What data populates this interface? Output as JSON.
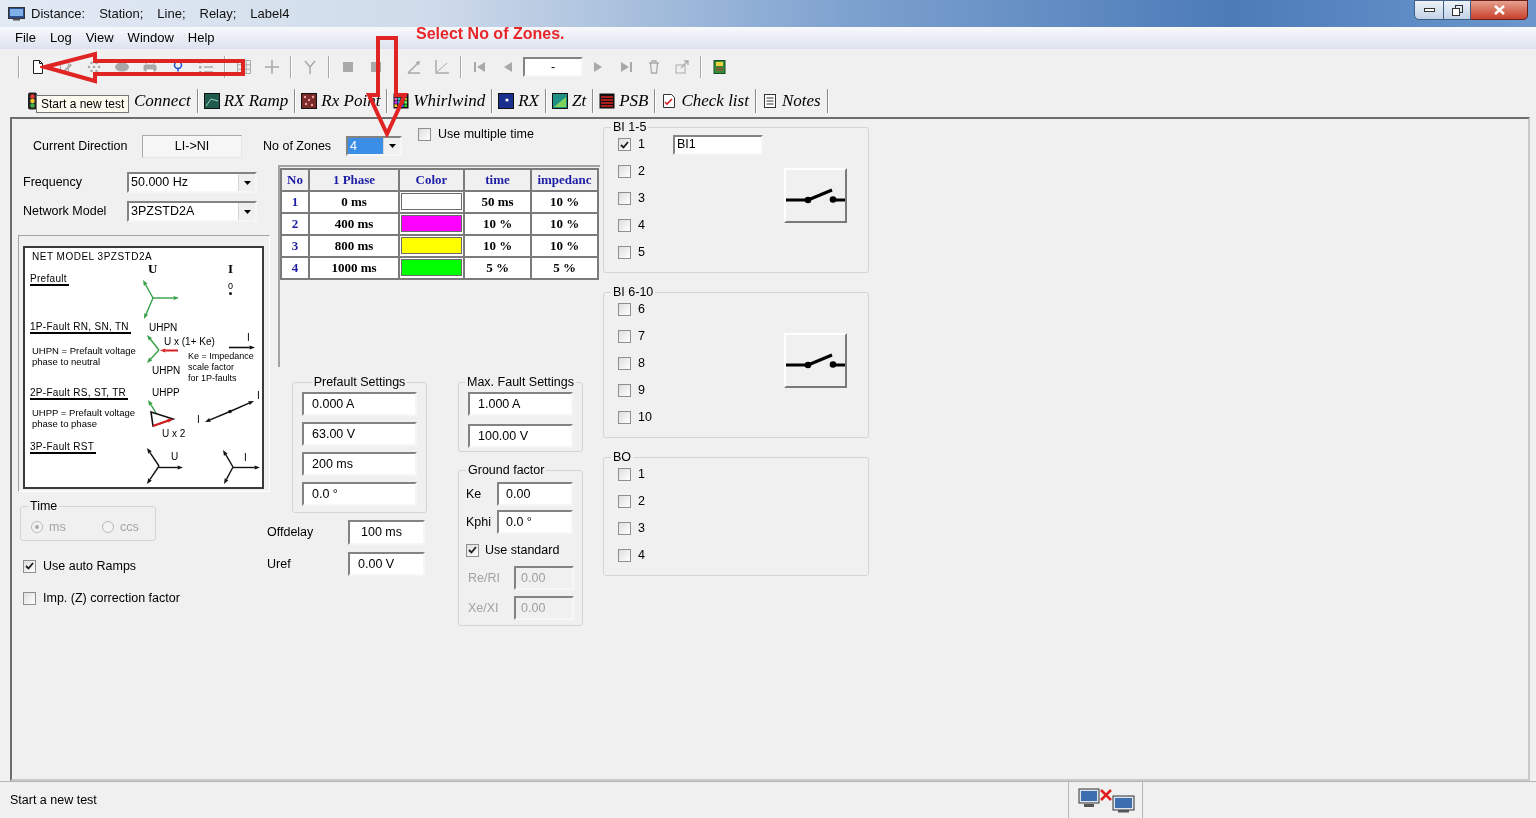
{
  "window": {
    "title": [
      "Distance:",
      "Station;",
      "Line;",
      "Relay;",
      "Label4"
    ]
  },
  "menu": [
    "File",
    "Log",
    "View",
    "Window",
    "Help"
  ],
  "annotation": "Select No of Zones.",
  "toolbar": {
    "groups": [
      [
        {
          "kind": "new",
          "disabled": false
        },
        {
          "kind": "edit",
          "disabled": true
        },
        {
          "kind": "dots",
          "disabled": true
        },
        {
          "kind": "ellipse",
          "disabled": true
        },
        {
          "kind": "printer",
          "disabled": true
        },
        {
          "kind": "marker",
          "disabled": false
        },
        {
          "kind": "list",
          "disabled": true
        }
      ],
      [
        {
          "kind": "grid",
          "disabled": true
        },
        {
          "kind": "plus",
          "disabled": true
        }
      ],
      [
        {
          "kind": "fork",
          "disabled": true
        }
      ],
      [
        {
          "kind": "square",
          "disabled": true
        },
        {
          "kind": "square",
          "disabled": true
        }
      ],
      [
        {
          "kind": "angle",
          "disabled": true
        },
        {
          "kind": "axes",
          "disabled": true
        }
      ],
      [
        {
          "kind": "first",
          "disabled": true
        },
        {
          "kind": "previous",
          "disabled": true
        },
        {
          "kind": "field",
          "value": "-"
        },
        {
          "kind": "next",
          "disabled": true
        },
        {
          "kind": "last",
          "disabled": true
        },
        {
          "kind": "bin",
          "disabled": true
        },
        {
          "kind": "export",
          "disabled": true
        }
      ],
      [
        {
          "kind": "book",
          "disabled": false
        }
      ]
    ]
  },
  "tooltip": "Start a new test",
  "tabs": [
    {
      "label": "Connect"
    },
    {
      "label": "RX Ramp"
    },
    {
      "label": "Rx Point"
    },
    {
      "label": "Whirlwind"
    },
    {
      "label": "RX"
    },
    {
      "label": "Zt"
    },
    {
      "label": "PSB"
    },
    {
      "label": "Check list"
    },
    {
      "label": "Notes"
    }
  ],
  "connection": {
    "current_direction": {
      "label": "Current Direction",
      "value": "LI->NI"
    },
    "zones": {
      "label": "No of Zones",
      "value": "4"
    },
    "multiple_time": {
      "label": "Use multiple time",
      "checked": false
    },
    "frequency": {
      "label": "Frequency",
      "value": "50.000 Hz"
    },
    "network_model": {
      "label": "Network Model",
      "value": "3PZSTD2A"
    }
  },
  "network_diagram": {
    "title": "NET MODEL 3PZSTD2A",
    "sections": [
      {
        "heading": "Prefault"
      },
      {
        "heading": "1P-Fault RN, SN, TN",
        "note": [
          "UHPN = Prefault voltage",
          "phase to neutral"
        ]
      },
      {
        "heading": "2P-Fault RS, ST, TR",
        "note": [
          "UHPP = Prefault voltage",
          "phase to phase"
        ]
      },
      {
        "heading": "3P-Fault RST"
      }
    ],
    "ke_note": [
      "Ke = Impedance",
      "scale factor",
      "for 1P-faults"
    ],
    "labels": [
      "U",
      "I",
      "0",
      "UHPN",
      "U x (1+ Ke)",
      "I",
      "UHPN",
      "UHPP",
      "I",
      "I",
      "U x 2",
      "U",
      "I"
    ]
  },
  "time": {
    "title": "Time",
    "disabled": true,
    "options": [
      {
        "label": "ms",
        "selected": true
      },
      {
        "label": "ccs",
        "selected": false
      }
    ]
  },
  "options": [
    {
      "label": "Use auto Ramps",
      "checked": true
    },
    {
      "label": "Imp. (Z) correction factor",
      "checked": false
    }
  ],
  "zones_table": {
    "columns": [
      "No",
      "1 Phase",
      "Color",
      "time",
      "impedanc"
    ],
    "rows": [
      {
        "no": "1",
        "phase": "0 ms",
        "color": "#ffffff",
        "time": "50 ms",
        "impedance": "10 %"
      },
      {
        "no": "2",
        "phase": "400 ms",
        "color": "#ff00ff",
        "time": "10 %",
        "impedance": "10 %"
      },
      {
        "no": "3",
        "phase": "800 ms",
        "color": "#ffff00",
        "time": "10 %",
        "impedance": "10 %"
      },
      {
        "no": "4",
        "phase": "1000 ms",
        "color": "#00ff00",
        "time": "5 %",
        "impedance": "5 %"
      }
    ]
  },
  "prefault_settings": {
    "title": "Prefault Settings",
    "values": [
      "0.000 A",
      "63.00 V",
      "200 ms",
      "0.0 °"
    ]
  },
  "offdelay": {
    "label": "Offdelay",
    "value": "100 ms"
  },
  "uref": {
    "label": "Uref",
    "value": "0.00 V"
  },
  "max_fault_settings": {
    "title": "Max. Fault Settings",
    "values": [
      "1.000 A",
      "100.00 V"
    ]
  },
  "ground_factor": {
    "title": "Ground factor",
    "factors": [
      {
        "label": "Ke",
        "value": "0.00"
      },
      {
        "label": "Kphi",
        "value": "0.0 °"
      }
    ],
    "use_standard": {
      "label": "Use standard",
      "checked": true
    },
    "ratios": [
      {
        "label": "Re/RI",
        "value": "0.00",
        "disabled": true
      },
      {
        "label": "Xe/XI",
        "value": "0.00",
        "disabled": true
      }
    ]
  },
  "binary_groups": [
    {
      "title": "BI 1-5",
      "kind": "input",
      "name_field": {
        "value": "BI1"
      },
      "items": [
        {
          "label": "1",
          "checked": true
        },
        {
          "label": "2",
          "checked": false
        },
        {
          "label": "3",
          "checked": false
        },
        {
          "label": "4",
          "checked": false
        },
        {
          "label": "5",
          "checked": false
        }
      ]
    },
    {
      "title": "BI 6-10",
      "kind": "input",
      "items": [
        {
          "label": "6",
          "checked": false
        },
        {
          "label": "7",
          "checked": false
        },
        {
          "label": "8",
          "checked": false
        },
        {
          "label": "9",
          "checked": false
        },
        {
          "label": "10",
          "checked": false
        }
      ]
    },
    {
      "title": "BO",
      "kind": "output",
      "items": [
        {
          "label": "1",
          "checked": false
        },
        {
          "label": "2",
          "checked": false
        },
        {
          "label": "3",
          "checked": false
        },
        {
          "label": "4",
          "checked": false
        }
      ]
    }
  ],
  "status_bar": {
    "text": "Start a new test"
  }
}
